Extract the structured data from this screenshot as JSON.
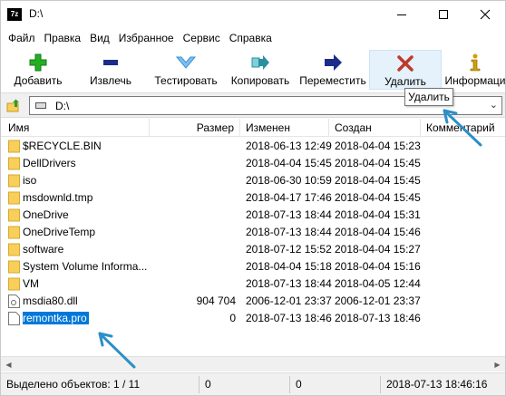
{
  "window": {
    "app_icon": "7z",
    "title": "D:\\",
    "controls": [
      "minimize-icon",
      "maximize-icon",
      "close-icon"
    ]
  },
  "menu": [
    "Файл",
    "Правка",
    "Вид",
    "Избранное",
    "Сервис",
    "Справка"
  ],
  "toolbar": {
    "add": "Добавить",
    "extract": "Извлечь",
    "test": "Тестировать",
    "copy": "Копировать",
    "move": "Переместить",
    "delete": "Удалить",
    "info": "Информаци"
  },
  "colors": {
    "add": "#22b022",
    "extract": "#1c2c8a",
    "test": "#3a8fd8",
    "copy": "#2a8f9f",
    "move": "#1c2c8a",
    "delete": "#c0392b",
    "info": "#d4a000",
    "selection": "#0078d7",
    "folder": "#f7cf5a",
    "annotation": "#2b8fc9"
  },
  "address": {
    "path": "D:\\"
  },
  "tooltip": "Удалить",
  "columns": {
    "name": "Имя",
    "size": "Размер",
    "modified": "Изменен",
    "created": "Создан",
    "comment": "Комментарий"
  },
  "files": [
    {
      "name": "$RECYCLE.BIN",
      "size": "",
      "modified": "2018-06-13 12:49",
      "created": "2018-04-04 15:23",
      "icon": "folder-icon"
    },
    {
      "name": "DellDrivers",
      "size": "",
      "modified": "2018-04-04 15:45",
      "created": "2018-04-04 15:45",
      "icon": "folder-icon"
    },
    {
      "name": "iso",
      "size": "",
      "modified": "2018-06-30 10:59",
      "created": "2018-04-04 15:45",
      "icon": "folder-icon"
    },
    {
      "name": "msdownld.tmp",
      "size": "",
      "modified": "2018-04-17 17:46",
      "created": "2018-04-04 15:45",
      "icon": "folder-icon"
    },
    {
      "name": "OneDrive",
      "size": "",
      "modified": "2018-07-13 18:44",
      "created": "2018-04-04 15:31",
      "icon": "folder-icon"
    },
    {
      "name": "OneDriveTemp",
      "size": "",
      "modified": "2018-07-13 18:44",
      "created": "2018-04-04 15:46",
      "icon": "folder-icon"
    },
    {
      "name": "software",
      "size": "",
      "modified": "2018-07-12 15:52",
      "created": "2018-04-04 15:27",
      "icon": "folder-icon"
    },
    {
      "name": "System Volume Informa...",
      "size": "",
      "modified": "2018-04-04 15:18",
      "created": "2018-04-04 15:16",
      "icon": "folder-icon"
    },
    {
      "name": "VM",
      "size": "",
      "modified": "2018-07-13 18:44",
      "created": "2018-04-05 12:44",
      "icon": "folder-icon"
    },
    {
      "name": "msdia80.dll",
      "size": "904 704",
      "modified": "2006-12-01 23:37",
      "created": "2006-12-01 23:37",
      "icon": "dll-file-icon"
    },
    {
      "name": "remontka.pro",
      "size": "0",
      "modified": "2018-07-13 18:46",
      "created": "2018-07-13 18:46",
      "icon": "file-icon",
      "selected": true
    }
  ],
  "status": {
    "selected": "Выделено объектов: 1 / 11",
    "size1": "0",
    "size2": "0",
    "datetime": "2018-07-13 18:46:16"
  }
}
